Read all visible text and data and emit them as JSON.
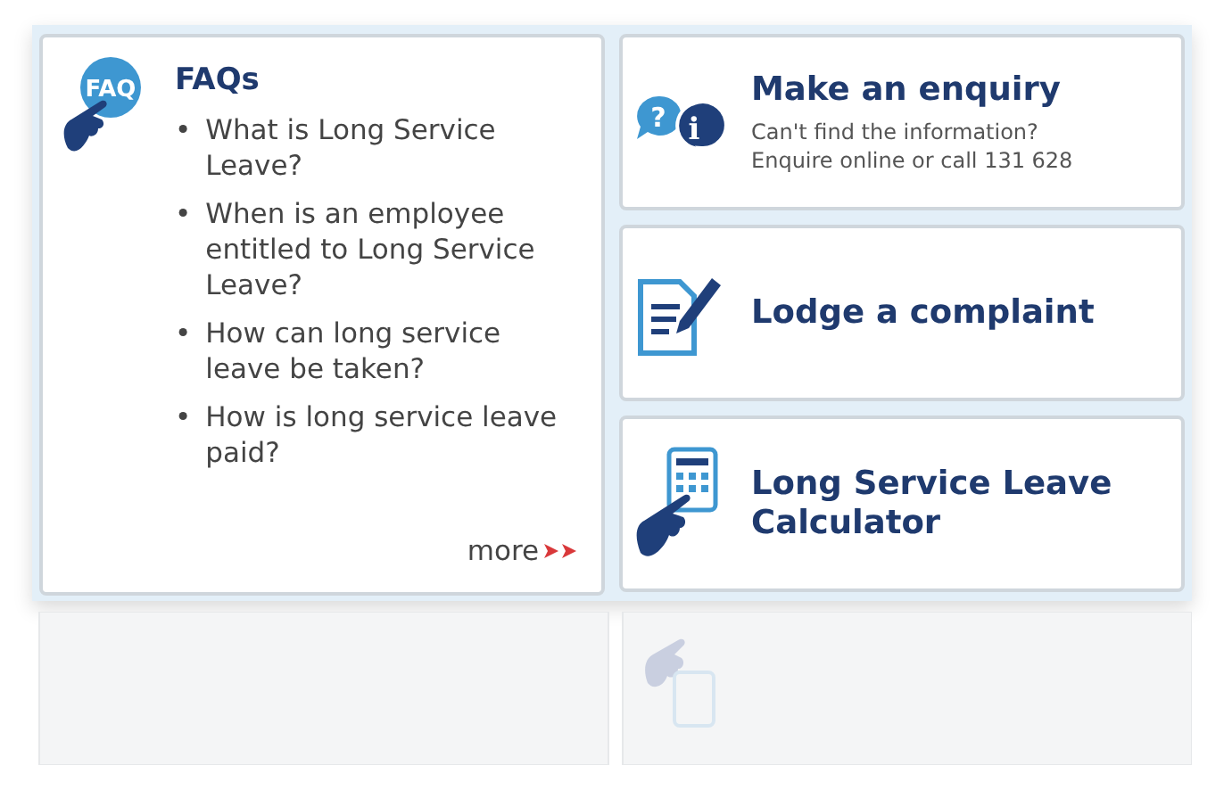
{
  "faq": {
    "icon_label": "FAQ",
    "title": "FAQs",
    "bullet": "•",
    "items": [
      "What is Long Service Leave?",
      "When is an employee entitled to Long Service Leave?",
      "How can long service leave be taken?",
      "How is long service leave paid?"
    ],
    "more": "more"
  },
  "cards": [
    {
      "kind": "enquiry",
      "title": "Make an enquiry",
      "subtitle": "Can't find the information?\nEnquire online or call 131 628",
      "icon_marks": [
        "?",
        "i"
      ]
    },
    {
      "kind": "complaint",
      "title": "Lodge a complaint"
    },
    {
      "kind": "calculator",
      "title": "Long Service Leave\nCalculator"
    }
  ]
}
